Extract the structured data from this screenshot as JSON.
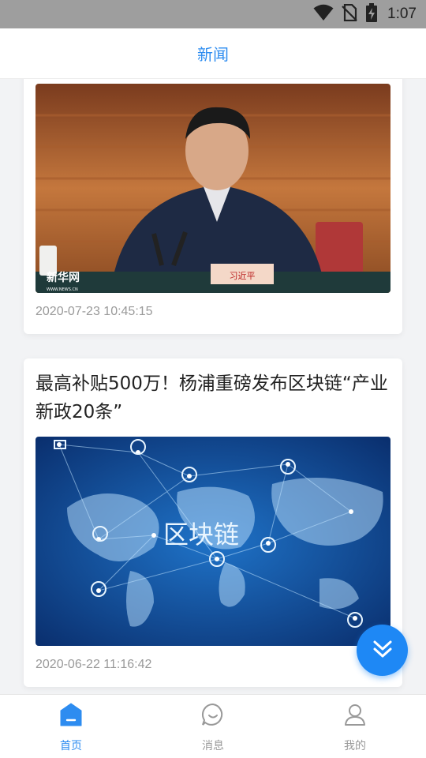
{
  "status_bar": {
    "time": "1:07",
    "icons": [
      "wifi-icon",
      "no-sim-icon",
      "battery-charging-icon"
    ]
  },
  "header": {
    "title": "新闻"
  },
  "articles": [
    {
      "title": "",
      "image_description_icon": "photo-icon",
      "image_watermark": "新华网",
      "image_watermark_url": "WWW.NEWS.CN",
      "image_nameplate": "习近平",
      "date": "2020-07-23 10:45:15"
    },
    {
      "title": "最高补贴500万！杨浦重磅发布区块链“产业新政20条”",
      "image_description_icon": "photo-icon",
      "image_caption": "区块链",
      "date": "2020-06-22 11:16:42"
    }
  ],
  "fab": {
    "icon": "double-chevron-down-icon"
  },
  "tabs": [
    {
      "label": "首页",
      "icon": "home-icon",
      "active": true
    },
    {
      "label": "消息",
      "icon": "message-icon",
      "active": false
    },
    {
      "label": "我的",
      "icon": "user-icon",
      "active": false
    }
  ],
  "colors": {
    "accent": "#2d8cf0",
    "fab": "#1e88f5",
    "status_bar": "#9e9e9e"
  }
}
